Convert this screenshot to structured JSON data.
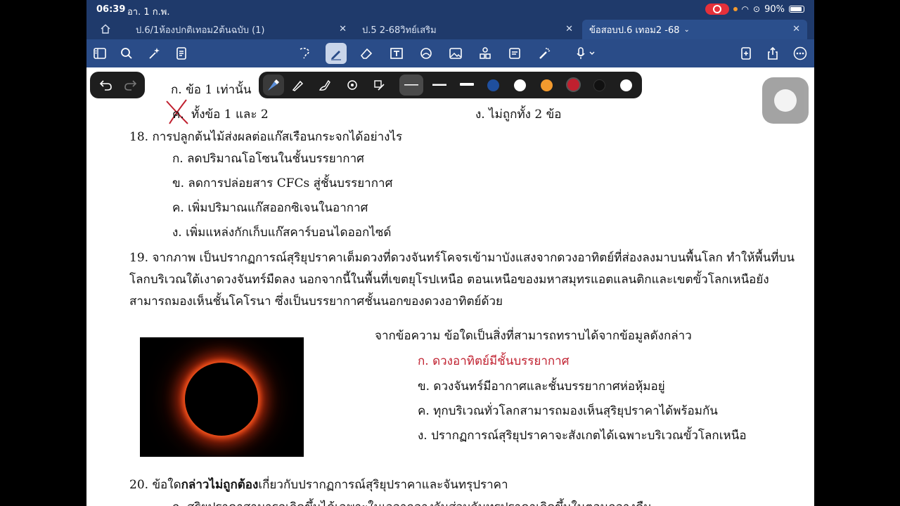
{
  "status": {
    "time": "06:39",
    "date": "อา. 1 ก.พ.",
    "battery": "90%",
    "battery_level": 0.9
  },
  "tabs": [
    {
      "label": "ป.6/1ห้องปกติเทอม2ต้นฉบับ (1)"
    },
    {
      "label": "ป.5 2-68วิทย์เสริม"
    },
    {
      "label": "ข้อสอบป.6 เทอม2 -68"
    }
  ],
  "toolbar_icons": [
    "sidebar-icon",
    "search-icon",
    "magic-icon",
    "document-icon",
    "lasso-icon",
    "pen-icon",
    "eraser-icon",
    "text-box-icon",
    "shapes-icon",
    "image-icon",
    "elements-icon",
    "sticky-note-icon",
    "laser-icon",
    "microphone-icon",
    "add-page-icon",
    "share-icon",
    "more-icon"
  ],
  "pen_colors": [
    "#1f4f9e",
    "#ffffff",
    "#f39a2e",
    "#c0202f",
    "#111111",
    "#ffffff"
  ],
  "doc": {
    "q17_a": "ก.  ข้อ 1 เท่านั้น",
    "q17_c": "ทั้งข้อ 1 และ 2",
    "q17_d": "ง.  ไม่ถูกทั้ง 2 ข้อ",
    "q18": "18. การปลูกต้นไม้ส่งผลต่อแก๊สเรือนกระจกได้อย่างไร",
    "q18_a": "ก. ลดปริมาณโอโซนในชั้นบรรยากาศ",
    "q18_b": "ข. ลดการปล่อยสาร CFCs สู่ชั้นบรรยากาศ",
    "q18_c": "ค. เพิ่มปริมาณแก๊สออกซิเจนในอากาศ",
    "q18_d": "ง. เพิ่มแหล่งกักเก็บแก๊สคาร์บอนไดออกไซด์",
    "q19_l1": "19. จากภาพ เป็นปรากฏการณ์สุริยุปราคาเต็มดวงที่ดวงจันทร์โคจรเข้ามาบังแสงจากดวงอาทิตย์ที่ส่องลงมาบนพื้นโลก ทำให้พื้นที่บน",
    "q19_l2": "โลกบริเวณใต้เงาดวงจันทร์มืดลง นอกจากนี้ในพื้นที่เขตยุโรปเหนือ ตอนเหนือของมหาสมุทรแอตแลนติกและเขตขั้วโลกเหนือยัง",
    "q19_l3": "สามารถมองเห็นชั้นโคโรนา ซึ่งเป็นบรรยากาศชั้นนอกของดวงอาทิตย์ด้วย",
    "q19_prompt": "จากข้อความ ข้อใดเป็นสิ่งที่สามารถทราบได้จากข้อมูลดังกล่าว",
    "q19_a": "ก. ดวงอาทิตย์มีชั้นบรรยากาศ",
    "q19_b": "ข. ดวงจันทร์มีอากาศและชั้นบรรยากาศห่อหุ้มอยู่",
    "q19_c": "ค. ทุกบริเวณทั่วโลกสามารถมองเห็นสุริยุปราคาได้พร้อมกัน",
    "q19_d": "ง. ปรากฏการณ์สุริยุปราคาจะสังเกตได้เฉพาะบริเวณขั้วโลกเหนือ",
    "q20_pre": "20. ข้อใด",
    "q20_bold": "กล่าวไม่ถูกต้อง",
    "q20_post": "เกี่ยวกับปรากฏการณ์สุริยุปราคาและจันทรุปราคา",
    "q20_a": "ก. สุริยุปราคาสามารถเกิดขึ้นได้เฉพาะในเวลากลางวันส่วนจันทรุปราคาเกิดขึ้นในตอนกลางคืน"
  }
}
